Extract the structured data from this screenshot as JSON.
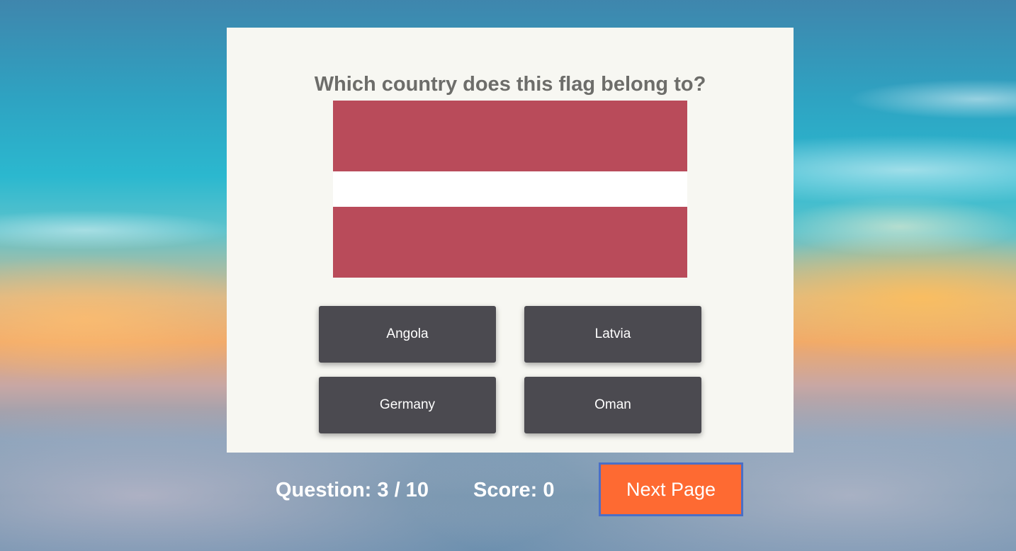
{
  "quiz": {
    "question": "Which country does this flag belong to?",
    "flag": {
      "country": "Latvia",
      "stripe_color": "#b94b5a",
      "middle_color": "#ffffff"
    },
    "answers": [
      "Angola",
      "Latvia",
      "Germany",
      "Oman"
    ]
  },
  "footer": {
    "question_counter": "Question: 3 / 10",
    "score": "Score: 0",
    "next_label": "Next Page"
  },
  "colors": {
    "card_background": "#f7f7f2",
    "answer_button": "#4b4a50",
    "next_button": "#fe6a32",
    "next_button_focus_ring": "#4a6fc7"
  }
}
